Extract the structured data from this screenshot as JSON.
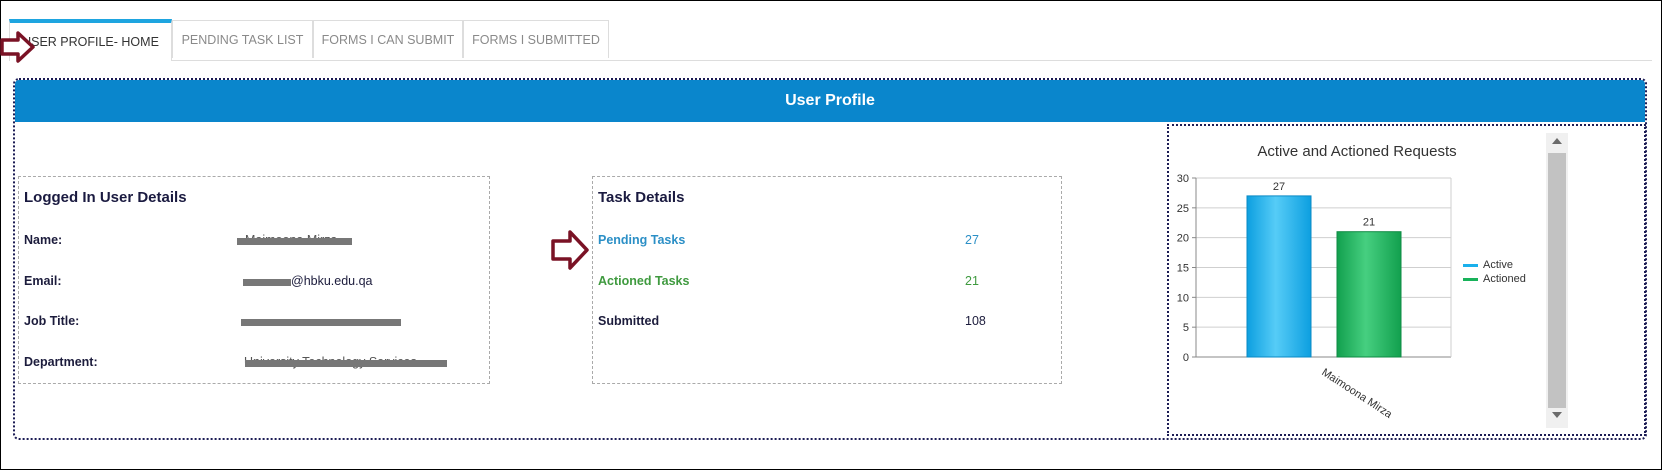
{
  "tabs": [
    {
      "label": "USER PROFILE- HOME",
      "active": true
    },
    {
      "label": "PENDING TASK LIST",
      "active": false
    },
    {
      "label": "FORMS I CAN SUBMIT",
      "active": false
    },
    {
      "label": "FORMS I SUBMITTED",
      "active": false
    }
  ],
  "panel": {
    "title": "User Profile"
  },
  "user_details": {
    "title": "Logged In User Details",
    "name_label": "Name:",
    "name_value": "Maimoona Mirza",
    "email_label": "Email:",
    "email_value": "@hbku.edu.qa",
    "job_label": "Job Title:",
    "job_value": "",
    "dept_label": "Department:",
    "dept_value": "University Technology Services"
  },
  "task_details": {
    "title": "Task Details",
    "pending_label": "Pending Tasks",
    "pending_value": "27",
    "actioned_label": "Actioned Tasks",
    "actioned_value": "21",
    "submitted_label": "Submitted",
    "submitted_value": "108"
  },
  "colors": {
    "header_bg": "#0a86cc",
    "pending": "#2b8fc6",
    "actioned": "#3f9a3f",
    "active_bar": "#1ab0ec",
    "actioned_bar": "#18b25a",
    "arrow": "#7a1225"
  },
  "chart_data": {
    "type": "bar",
    "title": "Active and Actioned Requests",
    "categories": [
      "Maimoona Mirza"
    ],
    "series": [
      {
        "name": "Active",
        "values": [
          27
        ]
      },
      {
        "name": "Actioned",
        "values": [
          21
        ]
      }
    ],
    "ylim": [
      0,
      30
    ],
    "yticks": [
      0,
      5,
      10,
      15,
      20,
      25,
      30
    ],
    "grid": true,
    "legend": "right"
  }
}
